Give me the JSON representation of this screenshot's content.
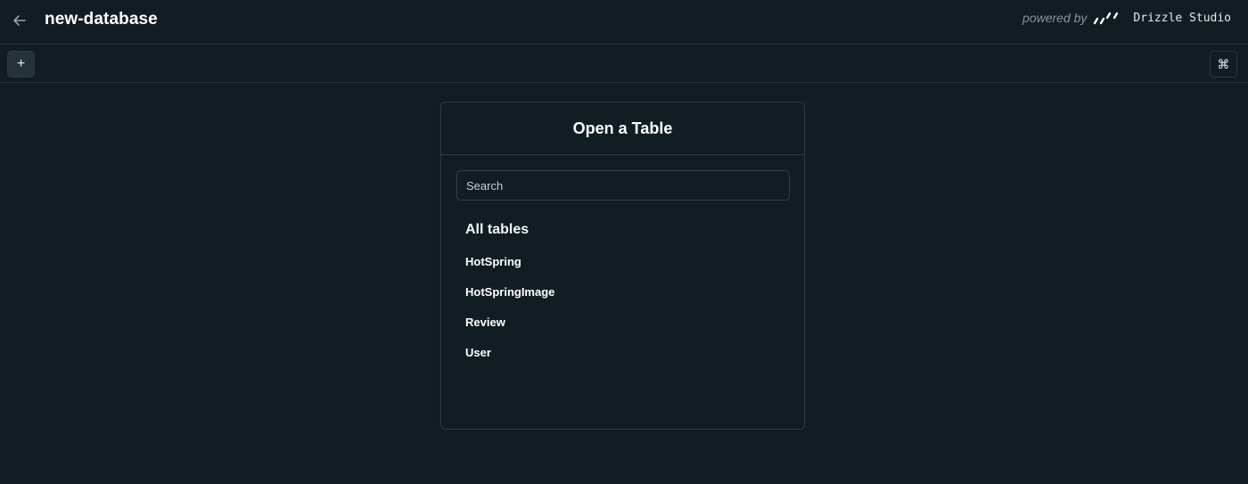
{
  "header": {
    "back_icon": "arrow-left-icon",
    "title": "new-database",
    "powered_by": "powered by",
    "brand_logo": "drizzle-logo-icon",
    "brand_name": "Drizzle Studio"
  },
  "toolbar": {
    "add_label": "+",
    "command_label": "⌘"
  },
  "panel": {
    "title": "Open a Table",
    "search_placeholder": "Search",
    "search_value": "",
    "section_title": "All tables",
    "tables": [
      "HotSpring",
      "HotSpringImage",
      "Review",
      "User"
    ]
  },
  "colors": {
    "background": "#111c23",
    "border": "#26323a",
    "text": "#ffffff",
    "muted": "#8a949a"
  }
}
